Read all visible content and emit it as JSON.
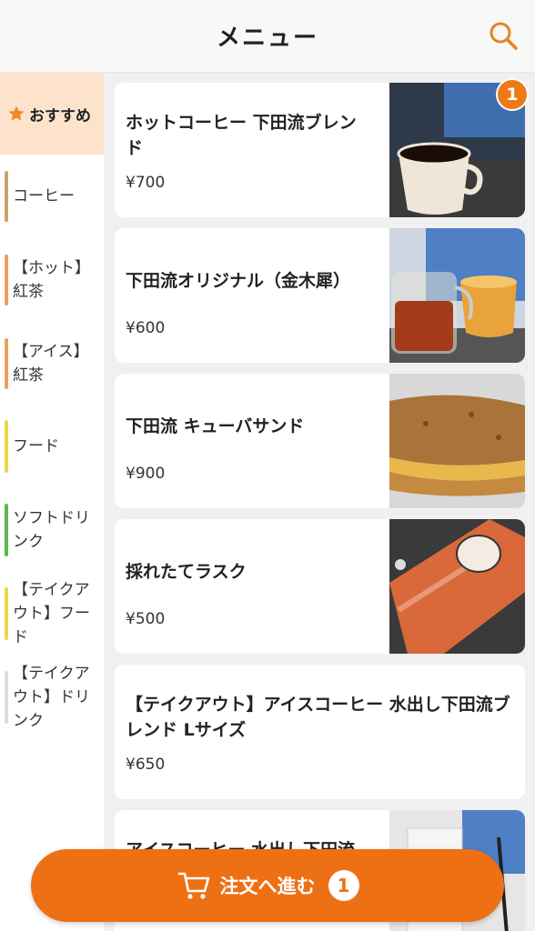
{
  "header": {
    "title": "メニュー"
  },
  "sidebar": {
    "recommend_label": "おすすめ",
    "items": [
      {
        "label": "コーヒー",
        "color": "#c9a36a"
      },
      {
        "label": "【ホット】紅茶",
        "color": "#e8a25c"
      },
      {
        "label": "【アイス】紅茶",
        "color": "#e8a25c"
      },
      {
        "label": "フード",
        "color": "#e8da4c"
      },
      {
        "label": "ソフトドリンク",
        "color": "#5cb84e"
      },
      {
        "label": "【テイクアウト】フード",
        "color": "#e8da4c"
      },
      {
        "label": "【テイクアウト】ドリンク",
        "color": "#dddddd"
      }
    ]
  },
  "cart_badge": "1",
  "menu": [
    {
      "name": "ホットコーヒー 下田流ブレンド",
      "price": "¥700",
      "image": "coffee-cup"
    },
    {
      "name": "下田流オリジナル（金木犀）",
      "price": "¥600",
      "image": "tea-pot"
    },
    {
      "name": "下田流 キューバサンド",
      "price": "¥900",
      "image": "sandwich"
    },
    {
      "name": "採れたてラスク",
      "price": "¥500",
      "image": "rusk-bag"
    },
    {
      "name": "【テイクアウト】アイスコーヒー 水出し下田流ブレンド Lサイズ",
      "price": "¥650",
      "image": ""
    },
    {
      "name": "アイスコーヒー 水出し下田流",
      "price": "",
      "image": "iced-coffee"
    }
  ],
  "order": {
    "label": "注文へ進む",
    "count": "1"
  },
  "colors": {
    "accent": "#ee7015",
    "recommend_bg": "#fde3cc"
  }
}
